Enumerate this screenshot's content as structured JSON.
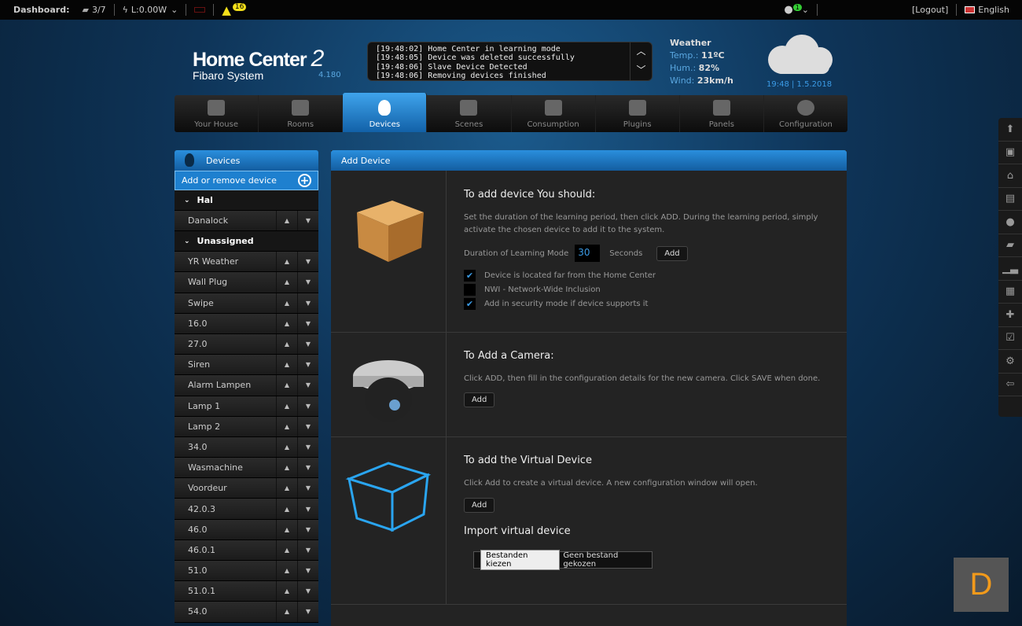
{
  "topbar": {
    "dashboard": "Dashboard:",
    "scenes": "3/7",
    "power": "L:0.00W",
    "alerts": "16",
    "user_badge": "1",
    "logout": "[Logout]",
    "language": "English"
  },
  "header": {
    "title": "Home Center",
    "title_num": "2",
    "subtitle": "Fibaro System",
    "version": "4.180",
    "log": [
      "[19:48:02] Home Center in learning mode",
      "[19:48:05] Device was deleted successfully",
      "[19:48:06] Slave Device Detected",
      "[19:48:06] Removing devices finished"
    ],
    "weather": {
      "title": "Weather",
      "temp_label": "Temp.:",
      "temp": "11ºC",
      "hum_label": "Hum.:",
      "hum": "82%",
      "wind_label": "Wind:",
      "wind": "23km/h"
    },
    "clock": "19:48 | 1.5.2018"
  },
  "nav": [
    "Your House",
    "Rooms",
    "Devices",
    "Scenes",
    "Consumption",
    "Plugins",
    "Panels",
    "Configuration"
  ],
  "sidebar": {
    "title": "Devices",
    "add": "Add or remove device",
    "groups": [
      {
        "name": "Hal",
        "items": [
          "Danalock"
        ]
      },
      {
        "name": "Unassigned",
        "items": [
          "YR Weather",
          "Wall Plug",
          "Swipe",
          "16.0",
          "27.0",
          "Siren",
          "Alarm Lampen",
          "Lamp 1",
          "Lamp 2",
          "34.0",
          "Wasmachine",
          "Voordeur",
          "42.0.3",
          "46.0",
          "46.0.1",
          "51.0",
          "51.0.1",
          "54.0"
        ]
      }
    ]
  },
  "main": {
    "title": "Add Device",
    "device": {
      "heading": "To add device You should:",
      "desc": "Set the duration of the learning period, then click ADD. During the learning period, simply activate the chosen device to add it to the system.",
      "duration_label": "Duration of Learning Mode",
      "duration": "30",
      "seconds": "Seconds",
      "add": "Add",
      "options": [
        {
          "label": "Device is located far from the Home Center",
          "checked": true
        },
        {
          "label": "NWI - Network-Wide Inclusion",
          "checked": false
        },
        {
          "label": "Add in security mode if device supports it",
          "checked": true
        }
      ]
    },
    "camera": {
      "heading": "To Add a Camera:",
      "desc": "Click ADD, then fill in the configuration details for the new camera. Click SAVE when done.",
      "add": "Add"
    },
    "virtual": {
      "heading": "To add the Virtual Device",
      "desc": "Click Add to create a virtual device. A new configuration window will open.",
      "add": "Add",
      "import_heading": "Import virtual device",
      "choose": "Bestanden kiezen",
      "no_file": "Geen bestand gekozen"
    }
  },
  "logo_letter": "D"
}
